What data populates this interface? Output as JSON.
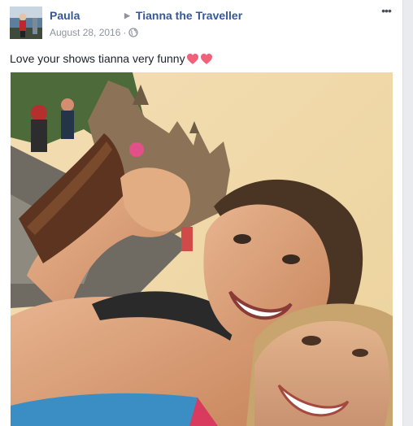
{
  "post": {
    "author_name": "Paula",
    "target_name": "Tianna the Traveller",
    "date": "August 28, 2016",
    "meta_separator": "·",
    "privacy_icon": "globe-icon",
    "text": "Love your shows tianna very funny",
    "emoji": [
      "heart-icon",
      "heart-icon"
    ],
    "more_icon": "ellipsis-icon",
    "more_label": "•••"
  },
  "colors": {
    "link": "#365899",
    "meta": "#90949c",
    "text": "#1d2129",
    "heart": "#f0627a",
    "page_bg": "#e9ebee"
  }
}
